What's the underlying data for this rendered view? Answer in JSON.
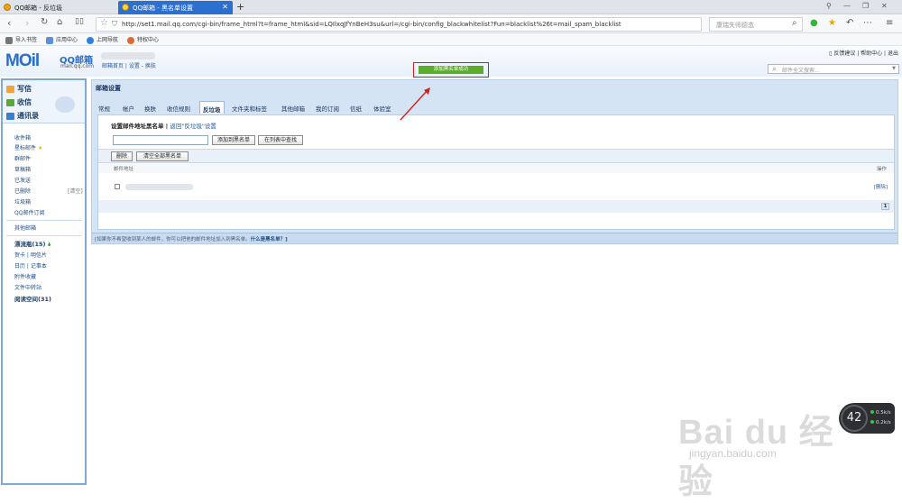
{
  "browser": {
    "tabs": [
      {
        "title": "QQ邮箱 - 反垃圾"
      },
      {
        "title": "QQ邮箱 - 黑名单设置"
      }
    ],
    "new_tab_glyph": "+",
    "url": "http://set1.mail.qq.com/cgi-bin/frame_html?t=frame_html&sid=LQIlxqJfYnBeH3su&url=/cgi-bin/config_blackwhitelist?Fun=blacklist%26t=mail_spam_blacklist",
    "search_text": "康瑞失师德态",
    "bookmarks": [
      "导入书签",
      "应用中心",
      "上网导航",
      "特权中心"
    ]
  },
  "header": {
    "logo": "MOil",
    "logo_text": "QQ邮箱",
    "logo_url": "mail.qq.com",
    "links": "邮箱首页 | 设置 - 换肤",
    "success_message": "添加黑名单成功",
    "top_links": "反馈建议 | 帮助中心 | 退出",
    "search_placeholder": "邮件全文搜索..."
  },
  "sidebar": {
    "compose": "写信",
    "receive": "收信",
    "contacts": "通讯录",
    "folders": [
      "收件箱",
      "星标邮件",
      "群邮件",
      "草稿箱",
      "已发送",
      "已删除",
      "垃圾箱",
      "QQ邮件订阅"
    ],
    "deleted_clear": "[清空]",
    "other_mail": "其他邮箱",
    "drift_bottle": "漂流瓶(15)",
    "card_label": "贺卡 | 明信片",
    "calendar_label": "日历 | 记事本",
    "attachments": "附件收藏",
    "file_transfer": "文件中转站",
    "reading_space": "阅读空间(31)"
  },
  "main": {
    "title": "邮箱设置",
    "tabs": [
      "常规",
      "帐户",
      "换肤",
      "收信规则",
      "反垃圾",
      "文件夹和标签",
      "其他邮箱",
      "我的订阅",
      "信纸",
      "体验室"
    ],
    "active_tab": "反垃圾",
    "panel_title": "设置邮件地址黑名单",
    "back_link": "返回\"反垃圾\"设置",
    "add_button": "添加到黑名单",
    "find_button": "在列表中查找",
    "delete_button": "删除",
    "clear_button": "清空全部黑名单",
    "col_address": "邮件地址",
    "col_action": "操作",
    "row_delete": "[删除]",
    "page": "1",
    "tip": "[如果你不希望收到某人的邮件，你可以把他的邮件地址加入到黑名单。",
    "tip_link": "什么是黑名单？]"
  },
  "watermark": {
    "brand": "Bai du 经验",
    "url": "jingyan.baidu.com"
  },
  "widget": {
    "value": "42",
    "up": "0.5k/s",
    "down": "0.2k/s"
  },
  "colors": {
    "accent": "#2a6ec9",
    "success": "#5cae2a",
    "highlight": "#d01f1f",
    "active_tab": "#2b6fcf"
  }
}
